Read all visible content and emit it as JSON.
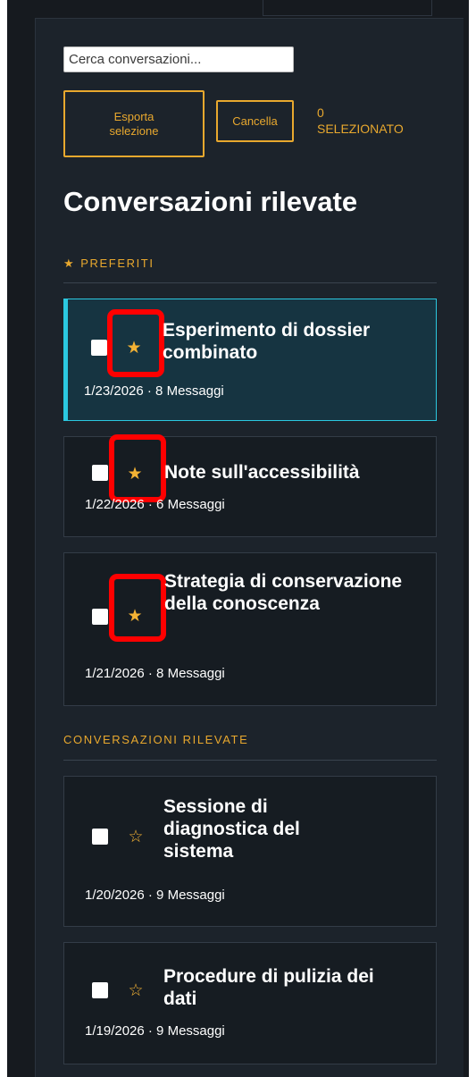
{
  "search": {
    "placeholder": "Cerca conversazioni..."
  },
  "toolbar": {
    "export_label": "Esporta\nselezione",
    "cancel_label": "Cancella",
    "selected_count": "0\nSELEZIONATO"
  },
  "page_title": "Conversazioni rilevate",
  "sections": {
    "favorites_label": "PREFERITI",
    "conversations_label": "CONVERSAZIONI RILEVATE"
  },
  "icons": {
    "section_star": "★",
    "star_filled": "★",
    "star_outline": "☆"
  },
  "colors": {
    "accent": "#e8a82e",
    "active_border": "#2bc8e0",
    "highlight": "#ff0000"
  },
  "favorites": [
    {
      "title": "Esperimento di dossier combinato",
      "date": "1/23/2026",
      "messages": "8 Messaggi",
      "meta": "1/23/2026 · 8 Messaggi",
      "starred": true,
      "active": true
    },
    {
      "title": "Note sull'accessibilità",
      "date": "1/22/2026",
      "messages": "6 Messaggi",
      "meta": "1/22/2026 · 6 Messaggi",
      "starred": true,
      "active": false
    },
    {
      "title": "Strategia di conservazione della conoscenza",
      "date": "1/21/2026",
      "messages": "8 Messaggi",
      "meta": "1/21/2026 · 8 Messaggi",
      "starred": true,
      "active": false
    }
  ],
  "conversations": [
    {
      "title": "Sessione di diagnostica del sistema",
      "date": "1/20/2026",
      "messages": "9 Messaggi",
      "meta": "1/20/2026 · 9 Messaggi",
      "starred": false
    },
    {
      "title": "Procedure di pulizia dei dati",
      "date": "1/19/2026",
      "messages": "9 Messaggi",
      "meta": "1/19/2026 · 9 Messaggi",
      "starred": false
    }
  ]
}
